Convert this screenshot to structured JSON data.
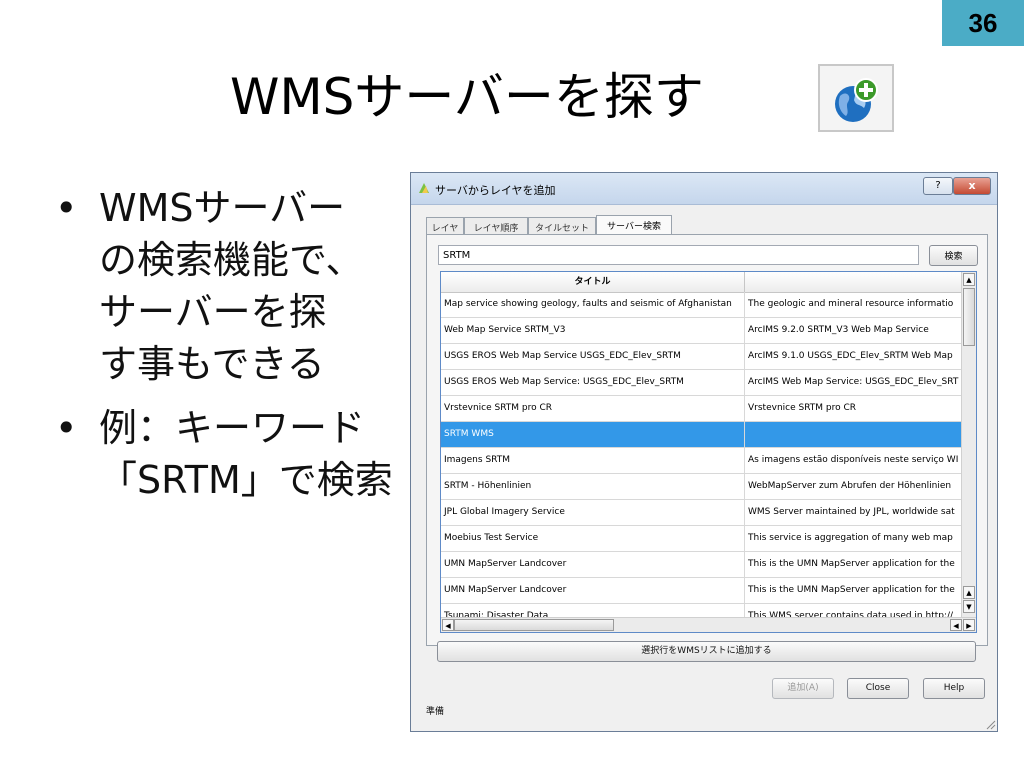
{
  "slide": {
    "number": "36",
    "title": "WMSサーバーを探す",
    "bullets": [
      {
        "marker": "•",
        "text": "WMSサーバー\nの検索機能で、\nサーバーを探\nす事もできる"
      },
      {
        "marker": "•",
        "text": "例：キーワード\n「SRTM」で検索"
      }
    ],
    "title_icon": "globe-add-icon"
  },
  "dialog": {
    "title": "サーバからレイヤを追加",
    "app_icon": "qgis-icon",
    "help_label": "?",
    "close_label": "x",
    "tabs": [
      {
        "label": "レイヤ",
        "active": false
      },
      {
        "label": "レイヤ順序",
        "active": false
      },
      {
        "label": "タイルセット",
        "active": false
      },
      {
        "label": "サーバー検索",
        "active": true
      }
    ],
    "search": {
      "value": "SRTM",
      "button_label": "検索"
    },
    "table": {
      "columns": [
        "タイトル",
        ""
      ],
      "rows": [
        {
          "title": "Map service showing geology, faults and seismic of Afghanistan",
          "desc": "The geologic and mineral resource informatio",
          "selected": false
        },
        {
          "title": "Web Map Service SRTM_V3",
          "desc": "ArcIMS 9.2.0 SRTM_V3 Web Map Service",
          "selected": false
        },
        {
          "title": "USGS EROS Web Map Service USGS_EDC_Elev_SRTM",
          "desc": "ArcIMS 9.1.0 USGS_EDC_Elev_SRTM Web Map",
          "selected": false
        },
        {
          "title": "USGS EROS Web Map Service: USGS_EDC_Elev_SRTM",
          "desc": "ArcIMS Web Map Service: USGS_EDC_Elev_SRT",
          "selected": false
        },
        {
          "title": "Vrstevnice SRTM pro CR",
          "desc": "Vrstevnice SRTM pro CR",
          "selected": false
        },
        {
          "title": "SRTM WMS",
          "desc": "",
          "selected": true
        },
        {
          "title": "Imagens SRTM",
          "desc": "As imagens estão disponíveis neste serviço WI",
          "selected": false
        },
        {
          "title": "SRTM - Höhenlinien",
          "desc": "WebMapServer zum Abrufen der Höhenlinien",
          "selected": false
        },
        {
          "title": "JPL Global Imagery Service",
          "desc": "WMS Server maintained by JPL, worldwide sat",
          "selected": false
        },
        {
          "title": "Moebius Test Service",
          "desc": "This service is aggregation of many web map",
          "selected": false
        },
        {
          "title": "UMN MapServer Landcover",
          "desc": "This is the UMN MapServer application for the",
          "selected": false
        },
        {
          "title": "UMN MapServer Landcover",
          "desc": "This is the UMN MapServer application for the",
          "selected": false
        },
        {
          "title": "Tsunami: Disaster Data",
          "desc": "This WMS server contains data used in http://",
          "selected": false
        }
      ]
    },
    "add_to_list_label": "選択行をWMSリストに追加する",
    "buttons": {
      "add": "追加(A)",
      "close": "Close",
      "help": "Help"
    },
    "status": "準備"
  }
}
